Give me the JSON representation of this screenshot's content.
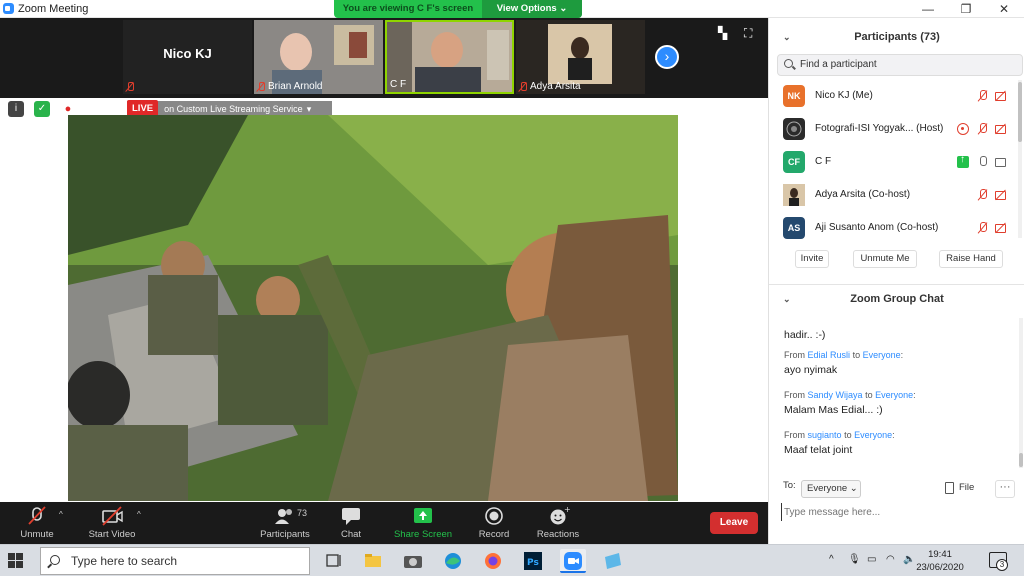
{
  "window": {
    "title": "Zoom Meeting",
    "viewing_banner": "You are viewing C F's screen",
    "view_options": "View Options"
  },
  "video_strip": {
    "tiles": [
      {
        "name": "Nico KJ",
        "muted": true
      },
      {
        "name": "Brian Arnold",
        "muted": true
      },
      {
        "name": "C F",
        "muted": false
      },
      {
        "name": "Adya Arsita",
        "muted": true
      }
    ]
  },
  "share": {
    "live_badge": "LIVE",
    "live_text": "on Custom Live Streaming Service"
  },
  "toolbar": {
    "unmute": "Unmute",
    "start_video": "Start Video",
    "participants": "Participants",
    "participants_count": "73",
    "chat": "Chat",
    "share_screen": "Share Screen",
    "record": "Record",
    "reactions": "Reactions",
    "leave": "Leave"
  },
  "participants_panel": {
    "title": "Participants (73)",
    "search_placeholder": "Find a participant",
    "rows": [
      {
        "initials": "NK",
        "name": "Nico KJ (Me)",
        "color": "#e8712b"
      },
      {
        "initials": "",
        "name": "Fotografi-ISI Yogyak... (Host)",
        "color": "#2b2b2b"
      },
      {
        "initials": "CF",
        "name": "C F",
        "color": "#23a86b"
      },
      {
        "initials": "",
        "name": "Adya Arsita (Co-host)",
        "color": "#b08a5a"
      },
      {
        "initials": "AS",
        "name": "Aji Susanto Anom (Co-host)",
        "color": "#24496e"
      }
    ],
    "invite": "Invite",
    "unmute_me": "Unmute Me",
    "raise_hand": "Raise Hand"
  },
  "chat_panel": {
    "title": "Zoom Group Chat",
    "partial_line": "hadir.. :-)",
    "messages": [
      {
        "from_prefix": "From",
        "sender": "Edial Rusli",
        "to_word": "to",
        "recipient": "Everyone",
        "text": "ayo nyimak"
      },
      {
        "from_prefix": "From",
        "sender": "Sandy Wijaya",
        "to_word": "to",
        "recipient": "Everyone",
        "text": "Malam Mas Edial... :)"
      },
      {
        "from_prefix": "From",
        "sender": "sugianto",
        "to_word": "to",
        "recipient": "Everyone",
        "text": "Maaf telat joint"
      }
    ],
    "to_label": "To:",
    "to_value": "Everyone",
    "file": "File",
    "input_placeholder": "Type message here..."
  },
  "taskbar": {
    "search_placeholder": "Type here to search",
    "time": "19:41",
    "date": "23/06/2020",
    "notification_count": "3"
  }
}
